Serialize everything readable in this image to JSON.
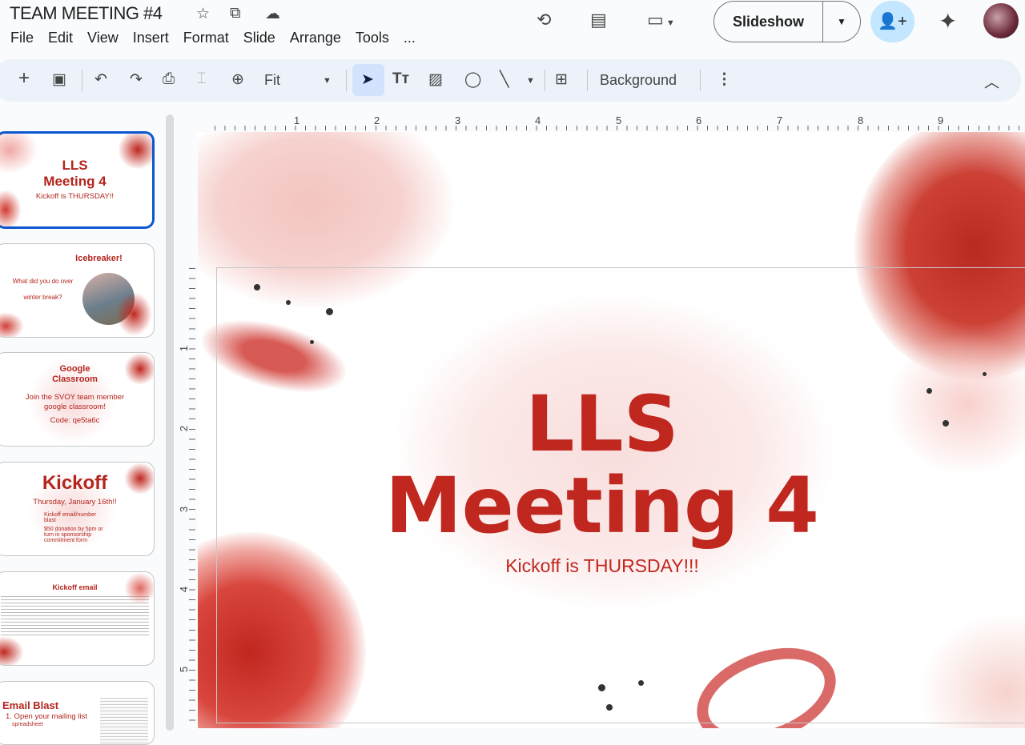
{
  "doc": {
    "title": "TEAM MEETING #4"
  },
  "menu": [
    "File",
    "Edit",
    "View",
    "Insert",
    "Format",
    "Slide",
    "Arrange",
    "Tools",
    "..."
  ],
  "header": {
    "slideshow_label": "Slideshow"
  },
  "toolbar": {
    "zoom_value": "Fit",
    "background_label": "Background"
  },
  "ruler": {
    "h": [
      "1",
      "2",
      "3",
      "4",
      "5",
      "6",
      "7",
      "8",
      "9"
    ],
    "v": [
      "1",
      "2",
      "3",
      "4",
      "5"
    ]
  },
  "slides": [
    {
      "title_a": "LLS",
      "title_b": "Meeting 4",
      "sub": "Kickoff is THURSDAY!!"
    },
    {
      "title": "Icebreaker!",
      "lines": [
        "What did you do over",
        "winter break?"
      ]
    },
    {
      "title_a": "Google",
      "title_b": "Classroom",
      "lines": [
        "Join the SVOY team member",
        "google classroom!",
        "Code: qe5ta6c"
      ]
    },
    {
      "title": "Kickoff",
      "date": "Thursday, January 16th!!",
      "bullets": [
        "Kickoff email/number blast",
        "$50 donation by 5pm or turn in sponsorship commitment form"
      ]
    },
    {
      "title": "Kickoff email"
    },
    {
      "title": "Email Blast",
      "lines": [
        "1. Open your mailing list",
        "spreadsheet"
      ]
    }
  ],
  "current_slide": {
    "title_line1": "LLS",
    "title_line2": "Meeting 4",
    "subtitle": "Kickoff is THURSDAY!!!"
  },
  "colors": {
    "accent": "#c0271f",
    "selection": "#0b57d0"
  }
}
